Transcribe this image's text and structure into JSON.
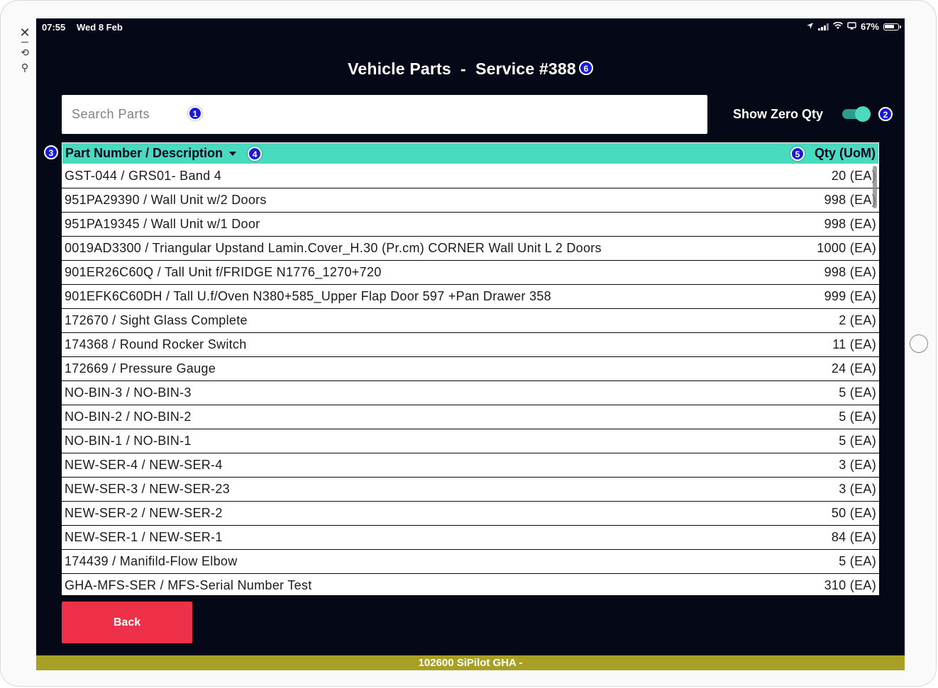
{
  "status_bar": {
    "time": "07:55",
    "date": "Wed 8 Feb",
    "battery": "67%",
    "icons": [
      "location-icon",
      "signal-icon",
      "wifi-icon",
      "screen-mirror-icon",
      "battery-icon"
    ]
  },
  "page": {
    "title": "Vehicle Parts  -  Service #388"
  },
  "markers": [
    "1",
    "2",
    "3",
    "4",
    "5",
    "6"
  ],
  "search": {
    "placeholder": "Search Parts",
    "value": ""
  },
  "toggle": {
    "label": "Show Zero Qty",
    "on": true
  },
  "table": {
    "headers": {
      "part": "Part Number / Description",
      "qty": "Qty (UoM)"
    },
    "sort": "descending",
    "rows": [
      {
        "part": "GST-044 / GRS01- Band 4",
        "qty": "20 (EA)"
      },
      {
        "part": "951PA29390 / Wall Unit w/2 Doors",
        "qty": "998 (EA)"
      },
      {
        "part": "951PA19345 / Wall Unit w/1 Door",
        "qty": "998 (EA)"
      },
      {
        "part": "0019AD3300 / Triangular Upstand Lamin.Cover_H.30 (Pr.cm) CORNER Wall Unit L 2 Doors",
        "qty": "1000 (EA)"
      },
      {
        "part": "901ER26C60Q / Tall Unit f/FRIDGE N1776_1270+720",
        "qty": "998 (EA)"
      },
      {
        "part": "901EFK6C60DH / Tall U.f/Oven N380+585_Upper Flap Door 597 +Pan Drawer 358",
        "qty": "999 (EA)"
      },
      {
        "part": "172670 / Sight Glass Complete",
        "qty": "2 (EA)"
      },
      {
        "part": "174368 / Round Rocker Switch",
        "qty": "11 (EA)"
      },
      {
        "part": "172669 / Pressure Gauge",
        "qty": "24 (EA)"
      },
      {
        "part": "NO-BIN-3 / NO-BIN-3",
        "qty": "5 (EA)"
      },
      {
        "part": "NO-BIN-2 / NO-BIN-2",
        "qty": "5 (EA)"
      },
      {
        "part": "NO-BIN-1 / NO-BIN-1",
        "qty": "5 (EA)"
      },
      {
        "part": "NEW-SER-4 / NEW-SER-4",
        "qty": "3 (EA)"
      },
      {
        "part": "NEW-SER-3 / NEW-SER-23",
        "qty": "3 (EA)"
      },
      {
        "part": "NEW-SER-2 / NEW-SER-2",
        "qty": "50 (EA)"
      },
      {
        "part": "NEW-SER-1 / NEW-SER-1",
        "qty": "84 (EA)"
      },
      {
        "part": "174439 / Manifild-Flow Elbow",
        "qty": "5 (EA)"
      },
      {
        "part": "GHA-MFS-SER / MFS-Serial Number Test",
        "qty": "310 (EA)"
      }
    ]
  },
  "buttons": {
    "back": "Back"
  },
  "footer": {
    "text": "102600 SiPilot GHA -"
  },
  "colors": {
    "background": "#050816",
    "header_accent": "#48dbc0",
    "toggle_on": "#4dd9bf",
    "back_button": "#ee3048",
    "footer_bar": "#a89f25",
    "marker": "#1a1ad6"
  }
}
